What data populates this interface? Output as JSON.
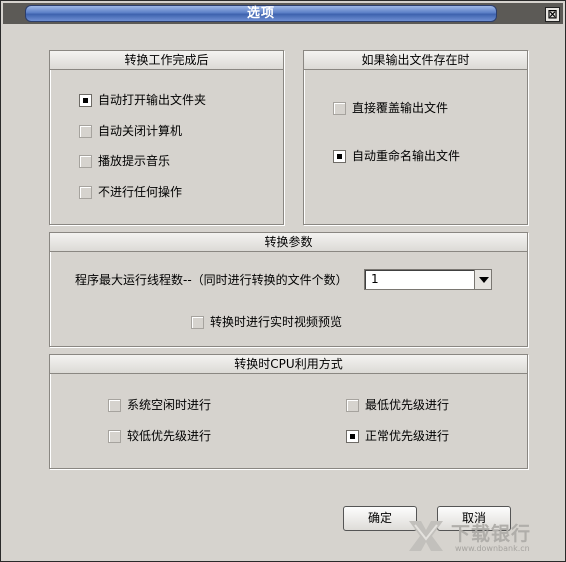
{
  "window": {
    "title": "选项",
    "close_symbol": "⊠"
  },
  "group_after_convert": {
    "header": "转换工作完成后",
    "options": [
      {
        "label": "自动打开输出文件夹",
        "checked": true
      },
      {
        "label": "自动关闭计算机",
        "checked": false
      },
      {
        "label": "播放提示音乐",
        "checked": false
      },
      {
        "label": "不进行任何操作",
        "checked": false
      }
    ]
  },
  "group_file_exists": {
    "header": "如果输出文件存在时",
    "options": [
      {
        "label": "直接覆盖输出文件",
        "checked": false
      },
      {
        "label": "自动重命名输出文件",
        "checked": true
      }
    ]
  },
  "group_params": {
    "header": "转换参数",
    "threads_label": "程序最大运行线程数--（同时进行转换的文件个数）",
    "threads_value": "1",
    "preview_label": "转换时进行实时视频预览",
    "preview_checked": false
  },
  "group_cpu": {
    "header": "转换时CPU利用方式",
    "options": [
      {
        "label": "系统空闲时进行",
        "checked": false
      },
      {
        "label": "最低优先级进行",
        "checked": false
      },
      {
        "label": "较低优先级进行",
        "checked": false
      },
      {
        "label": "正常优先级进行",
        "checked": true
      }
    ]
  },
  "buttons": {
    "ok": "确定",
    "cancel": "取消"
  },
  "watermark": {
    "name": "下载银行",
    "url": "www.downbank.cn"
  }
}
